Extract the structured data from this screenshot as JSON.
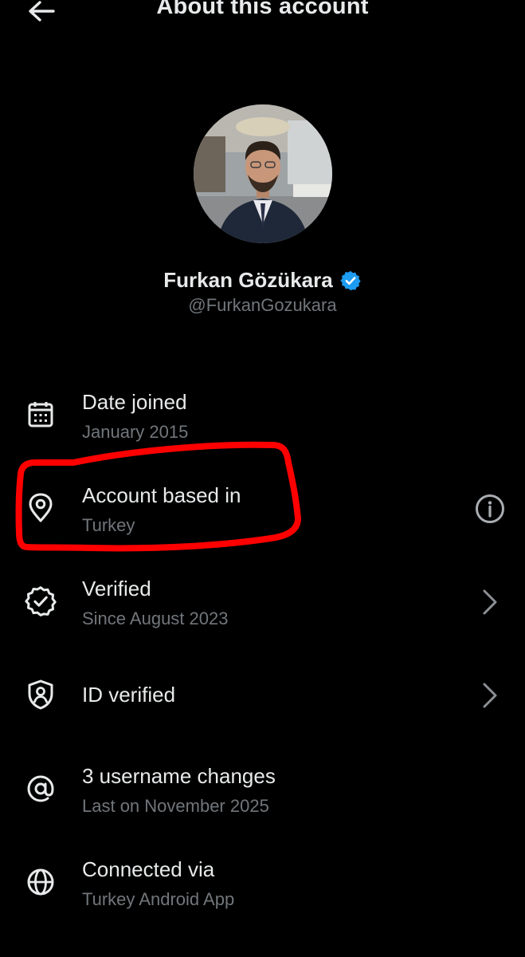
{
  "header": {
    "title": "About this account",
    "back_icon": "arrow-left-icon"
  },
  "profile": {
    "name": "Furkan Gözükara",
    "handle": "@FurkanGozukara",
    "verified_badge_color": "#1d9bf0"
  },
  "items": [
    {
      "icon": "calendar-icon",
      "title": "Date joined",
      "subtitle": "January 2015",
      "action": "none"
    },
    {
      "icon": "location-pin-icon",
      "title": "Account based in",
      "subtitle": "Turkey",
      "action": "info"
    },
    {
      "icon": "verified-badge-icon",
      "title": "Verified",
      "subtitle": "Since August 2023",
      "action": "chevron"
    },
    {
      "icon": "shield-person-icon",
      "title": "ID verified",
      "subtitle": "",
      "action": "chevron"
    },
    {
      "icon": "at-sign-icon",
      "title": "3 username changes",
      "subtitle": "Last on November 2025",
      "action": "none"
    },
    {
      "icon": "globe-icon",
      "title": "Connected via",
      "subtitle": "Turkey Android App",
      "action": "none"
    }
  ],
  "colors": {
    "background": "#000000",
    "primary_text": "#e7e9ea",
    "secondary_text": "#71767b",
    "annotation": "#ff0000"
  }
}
